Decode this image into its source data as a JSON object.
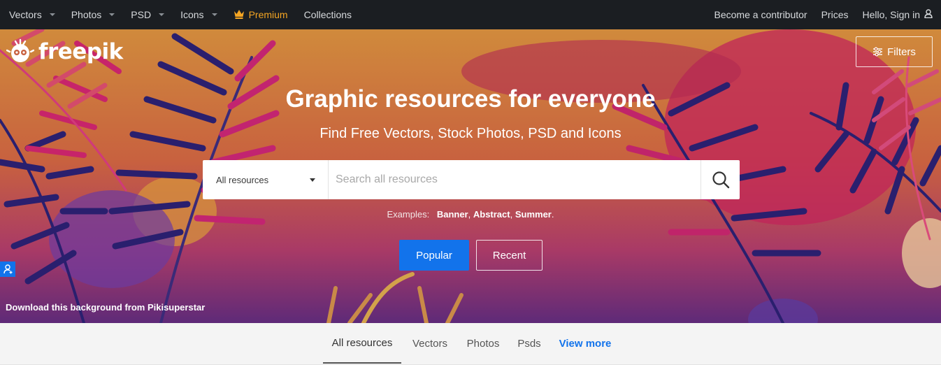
{
  "nav": {
    "left": [
      {
        "label": "Vectors",
        "has_dropdown": true
      },
      {
        "label": "Photos",
        "has_dropdown": true
      },
      {
        "label": "PSD",
        "has_dropdown": true
      },
      {
        "label": "Icons",
        "has_dropdown": true
      }
    ],
    "premium_label": "Premium",
    "premium_icon": "crown-icon",
    "collections_label": "Collections",
    "right": {
      "contributor_label": "Become a contributor",
      "prices_label": "Prices",
      "signin_label": "Hello, Sign in",
      "signin_icon": "user-icon"
    }
  },
  "brand": {
    "name": "freepik"
  },
  "hero": {
    "filters_label": "Filters",
    "title": "Graphic resources for everyone",
    "subtitle": "Find Free Vectors, Stock Photos, PSD and Icons",
    "search": {
      "category": "All resources",
      "placeholder": "Search all resources",
      "value": ""
    },
    "examples_label": "Examples:",
    "examples": [
      "Banner",
      "Abstract",
      "Summer"
    ],
    "popular_label": "Popular",
    "recent_label": "Recent",
    "credit": "Download this background from Pikisuperstar"
  },
  "tabs": [
    {
      "label": "All resources",
      "active": true
    },
    {
      "label": "Vectors",
      "active": false
    },
    {
      "label": "Photos",
      "active": false
    },
    {
      "label": "Psds",
      "active": false
    },
    {
      "label": "View more",
      "active": false
    }
  ],
  "colors": {
    "nav_bg": "#1b1e22",
    "premium": "#f5a623",
    "accent_blue": "#1273eb",
    "hero_top": "#c8743c",
    "hero_bottom": "#6a2a77"
  }
}
